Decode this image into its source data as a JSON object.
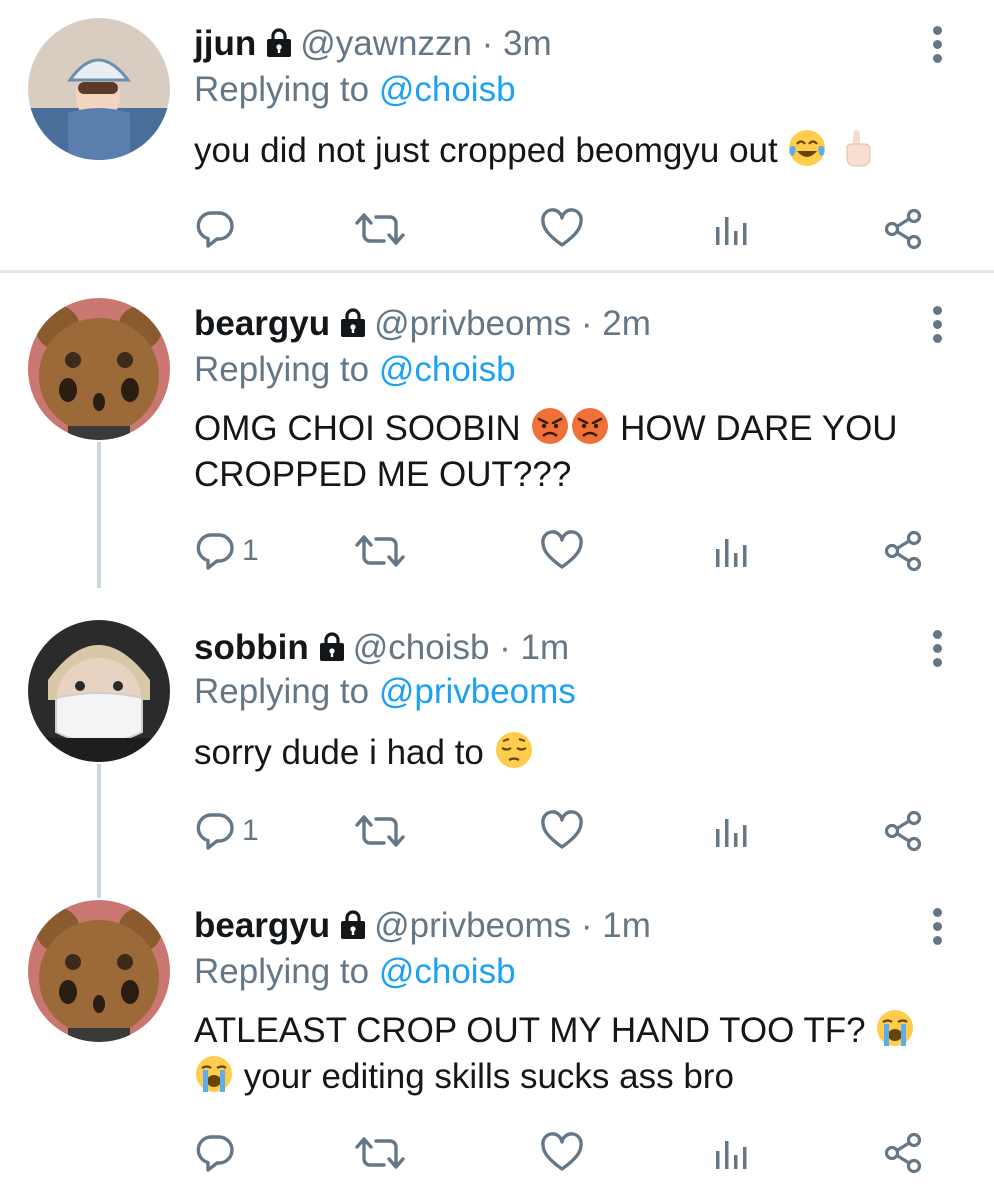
{
  "colors": {
    "accent": "#1da1f2",
    "muted": "#657786",
    "text": "#14171a",
    "divider": "#e1e8ed"
  },
  "tweets": [
    {
      "name": "jjun",
      "handle": "@yawnzzn",
      "dot": "·",
      "time": "3m",
      "replying_prefix": "Replying to ",
      "replying_to": "@choisb",
      "text_parts": [
        "you did not just cropped beomgyu out "
      ],
      "emojis": [
        "face-with-tears-of-joy",
        "index-pointing-up"
      ],
      "reply_count": "",
      "avatar": "girl-with-helmet-avatar"
    },
    {
      "name": "beargyu",
      "handle": "@privbeoms",
      "dot": "·",
      "time": "2m",
      "replying_prefix": "Replying to ",
      "replying_to": "@choisb",
      "text_parts": [
        "OMG CHOI SOOBIN ",
        " HOW DARE YOU CROPPED ME OUT???"
      ],
      "emojis": [
        "angry-face",
        "angry-face"
      ],
      "reply_count": "1",
      "avatar": "teddy-bear-avatar"
    },
    {
      "name": "sobbin",
      "handle": "@choisb",
      "dot": "·",
      "time": "1m",
      "replying_prefix": "Replying to ",
      "replying_to": "@privbeoms",
      "text_parts": [
        "sorry dude i had to "
      ],
      "emojis": [
        "pensive-face"
      ],
      "reply_count": "1",
      "avatar": "masked-person-avatar"
    },
    {
      "name": "beargyu",
      "handle": "@privbeoms",
      "dot": "·",
      "time": "1m",
      "replying_prefix": "Replying to ",
      "replying_to": "@choisb",
      "text_parts": [
        "ATLEAST CROP OUT MY HAND TOO TF? ",
        " your editing skills sucks ass bro"
      ],
      "emojis": [
        "loudly-crying-face",
        "loudly-crying-face"
      ],
      "reply_count": "",
      "avatar": "teddy-bear-avatar"
    }
  ],
  "action_icons": [
    "reply-icon",
    "retweet-icon",
    "like-icon",
    "analytics-icon",
    "share-icon"
  ]
}
